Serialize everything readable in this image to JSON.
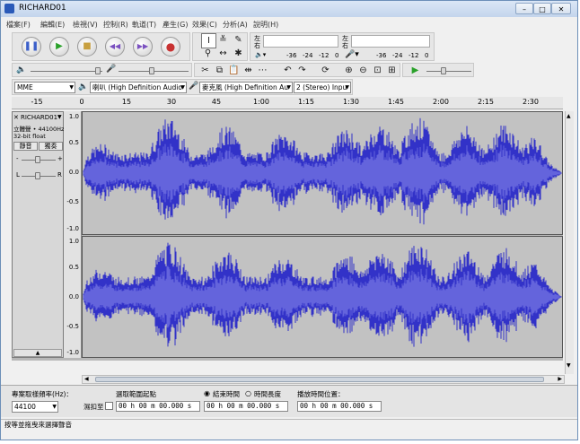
{
  "window": {
    "title": "RICHARD01"
  },
  "menu": [
    "檔案(F)",
    "編輯(E)",
    "檢視(V)",
    "控制(R)",
    "軌道(T)",
    "產生(G)",
    "效果(C)",
    "分析(A)",
    "說明(H)"
  ],
  "meters": {
    "left_label": "左",
    "right_label": "右",
    "play_scale": [
      "-36",
      "-24",
      "-12",
      "0"
    ],
    "rec_scale": [
      "-36",
      "-24",
      "-12",
      "0"
    ]
  },
  "device": {
    "host": "MME",
    "output": "喇叭 (High Definition Audio",
    "input": "麥克風 (High Definition Au",
    "channels": "2 (Stereo) Inpu"
  },
  "ruler": {
    "ticks": [
      "-15",
      "0",
      "15",
      "30",
      "45",
      "1:00",
      "1:15",
      "1:30",
      "1:45",
      "2:00",
      "2:15",
      "2:30"
    ]
  },
  "track": {
    "name": "RICHARD01",
    "info1": "立體聲 • 44100Hz",
    "info2": "32-bit float",
    "mute": "靜音",
    "solo": "獨奏",
    "scale": [
      "1.0",
      "0.5",
      "0.0",
      "-0.5",
      "-1.0"
    ]
  },
  "selection": {
    "rate_label": "專案取樣頻率(Hz)：",
    "rate_value": "44100",
    "snap_label": "濕扣至",
    "start_label": "選取範圍起點",
    "end_label": "結束時間",
    "length_label": "時間長度",
    "audio_pos_label": "播放時間位置：",
    "start_value": "00 h 00 m 00.000 s",
    "end_value": "00 h 00 m 00.000 s",
    "audio_pos_value": "00 h 00 m 00.000 s"
  },
  "status": "按等並拖曳來選擇聲音",
  "colors": {
    "wave": "#3232c8",
    "wave_rms": "#6464dc",
    "track_bg": "#c2c2c2",
    "play": "#2aa12a",
    "record": "#c83232"
  }
}
